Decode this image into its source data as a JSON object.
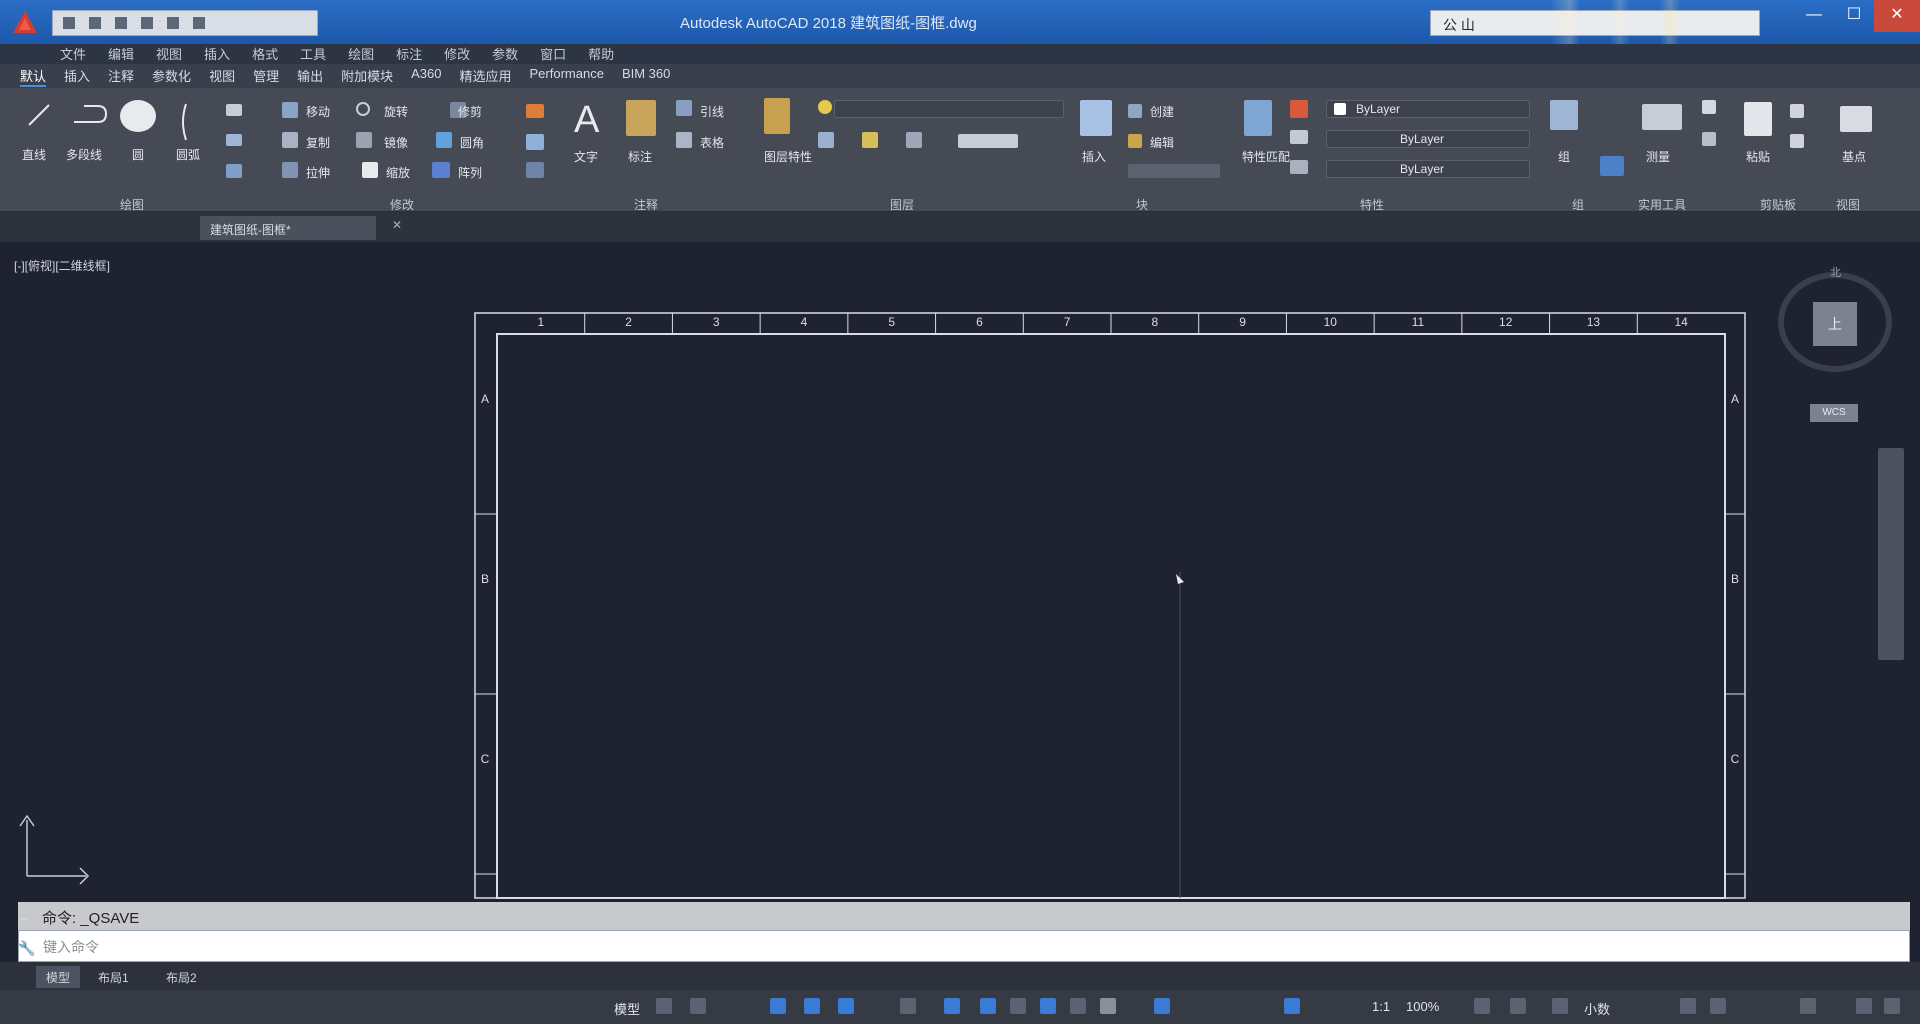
{
  "titlebar": {
    "title": "Autodesk AutoCAD 2018  建筑图纸-图框.dwg",
    "search_text": "公 山"
  },
  "menu": [
    "文件",
    "编辑",
    "视图",
    "插入",
    "格式",
    "工具",
    "绘图",
    "标注",
    "修改",
    "参数",
    "窗口",
    "帮助"
  ],
  "ribbon_tabs": [
    "默认",
    "插入",
    "注释",
    "参数化",
    "视图",
    "管理",
    "输出",
    "附加模块",
    "A360",
    "精选应用",
    "Performance",
    "BIM 360"
  ],
  "ribbon_tools": {
    "line": "直线",
    "polyline": "多段线",
    "circle": "圆",
    "arc": "圆弧",
    "move": "移动",
    "rotate": "旋转",
    "trim": "修剪",
    "copy": "复制",
    "mirror": "镜像",
    "fillet": "圆角",
    "stretch": "拉伸",
    "scale": "缩放",
    "array": "阵列",
    "text": "文字",
    "dimension": "标注",
    "leader": "引线",
    "table": "表格",
    "layer_props": "图层特性",
    "insert": "插入",
    "create": "创建",
    "edit": "编辑",
    "match_props": "特性匹配",
    "bylayer1": "ByLayer",
    "bylayer2": "ByLayer",
    "bylayer3": "ByLayer",
    "group": "组",
    "measure": "测量",
    "paste": "粘贴",
    "base": "基点"
  },
  "ribbon_panels": [
    "绘图",
    "修改",
    "注释",
    "图层",
    "块",
    "特性",
    "组",
    "实用工具",
    "剪贴板",
    "视图"
  ],
  "doc_tab": "建筑图纸-图框*",
  "viewport_label": "[-][俯视][二维线框]",
  "frame": {
    "columns": [
      "1",
      "2",
      "3",
      "4",
      "5",
      "6",
      "7",
      "8",
      "9",
      "10",
      "11",
      "12",
      "13",
      "14"
    ],
    "rows": [
      "A",
      "B",
      "C"
    ]
  },
  "viewcube": {
    "n": "北",
    "face": "上",
    "wcs": "WCS"
  },
  "command": {
    "history": "命令: _QSAVE",
    "prompt": "键入命令"
  },
  "layout_tabs": [
    "模型",
    "布局1",
    "布局2"
  ],
  "status": {
    "model": "模型",
    "scale": "1:1",
    "zoom": "100%",
    "units": "小数"
  }
}
